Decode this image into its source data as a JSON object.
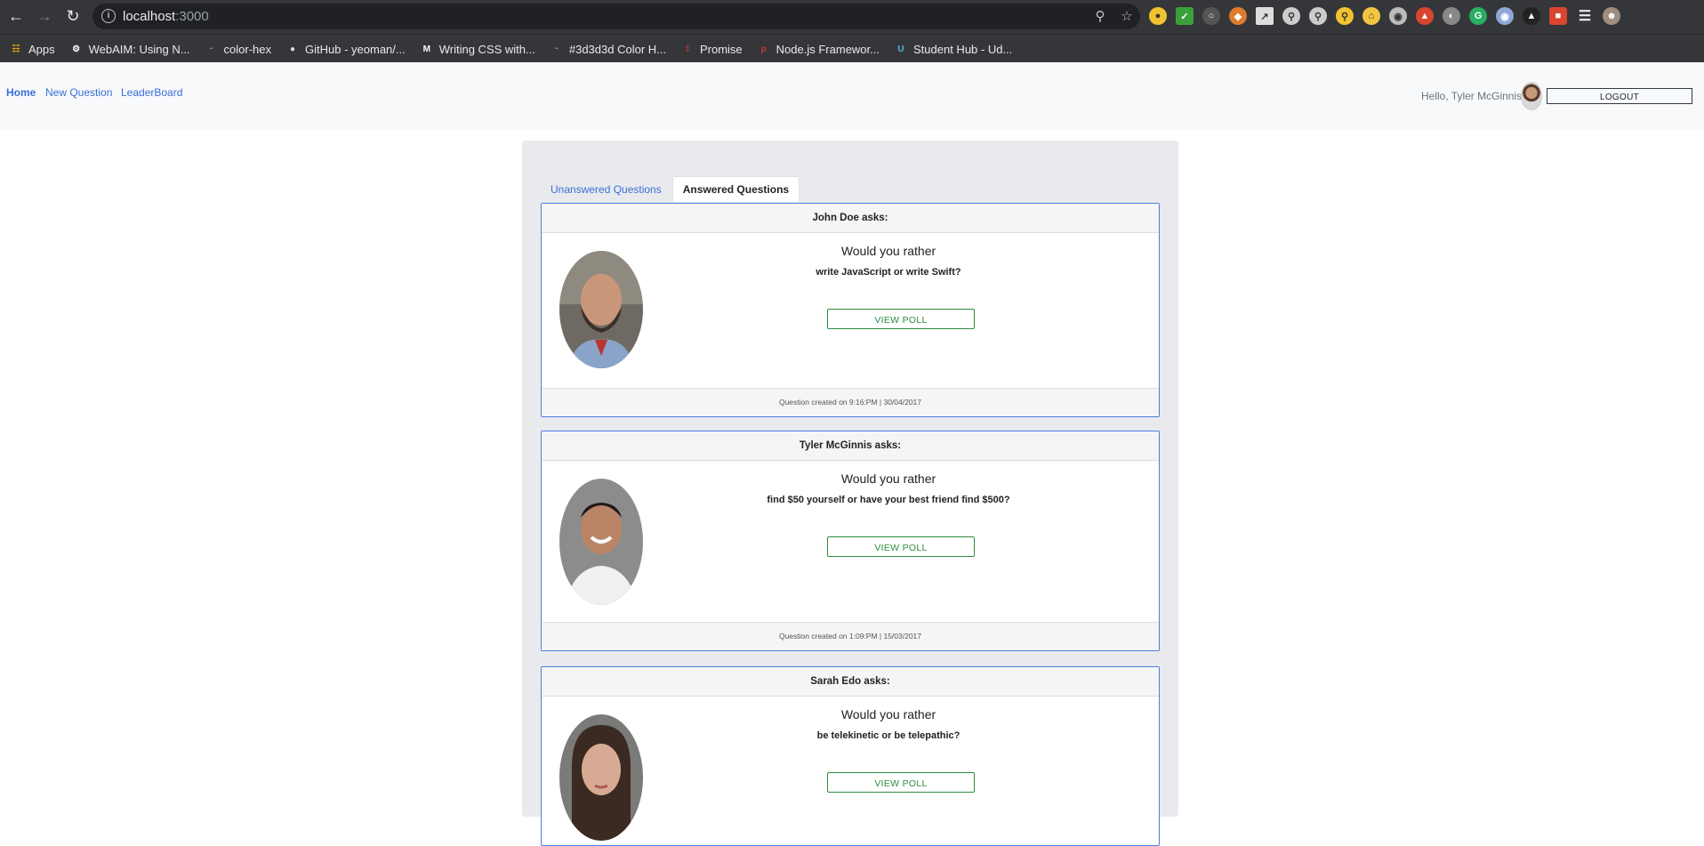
{
  "browser": {
    "url_host": "localhost",
    "url_port": ":3000",
    "bookmarks": [
      {
        "label": "Apps",
        "icon": "apps-grid-icon",
        "color": "#f4b400"
      },
      {
        "label": "WebAIM: Using N...",
        "icon": "webaim-icon",
        "color": "#ffffff"
      },
      {
        "label": "color-hex",
        "icon": "color-hex-icon",
        "color": "#777777"
      },
      {
        "label": "GitHub - yeoman/...",
        "icon": "github-icon",
        "color": "#dddddd"
      },
      {
        "label": "Writing CSS with...",
        "icon": "medium-icon",
        "color": "#ffffff"
      },
      {
        "label": "#3d3d3d Color H...",
        "icon": "color-hex-icon",
        "color": "#777777"
      },
      {
        "label": "Promise",
        "icon": "promise-icon",
        "color": "#c0392b"
      },
      {
        "label": "Node.js Framewor...",
        "icon": "pinterest-icon",
        "color": "#c0392b"
      },
      {
        "label": "Student Hub - Ud...",
        "icon": "udacity-icon",
        "color": "#4fb3e8"
      }
    ]
  },
  "nav": {
    "home": "Home",
    "new_question": "New Question",
    "leaderboard": "LeaderBoard",
    "greeting": "Hello, Tyler McGinnis",
    "logout": "LOGOUT"
  },
  "tabs": {
    "unanswered": "Unanswered Questions",
    "answered": "Answered Questions"
  },
  "questions": [
    {
      "header": "John Doe asks:",
      "prompt": "Would you rather",
      "options": "write JavaScript or write Swift?",
      "button": "VIEW POLL",
      "footer": "Question created on 9:16:PM | 30/04/2017"
    },
    {
      "header": "Tyler McGinnis asks:",
      "prompt": "Would you rather",
      "options": "find $50 yourself or have your best friend find $500?",
      "button": "VIEW POLL",
      "footer": "Question created on 1:09:PM | 15/03/2017"
    },
    {
      "header": "Sarah Edo asks:",
      "prompt": "Would you rather",
      "options": "be telekinetic or be telepathic?",
      "button": "VIEW POLL",
      "footer": ""
    }
  ],
  "colors": {
    "link": "#3a6fd8",
    "card_border": "#4d7fe0",
    "poll_button": "#2e8b3e"
  }
}
